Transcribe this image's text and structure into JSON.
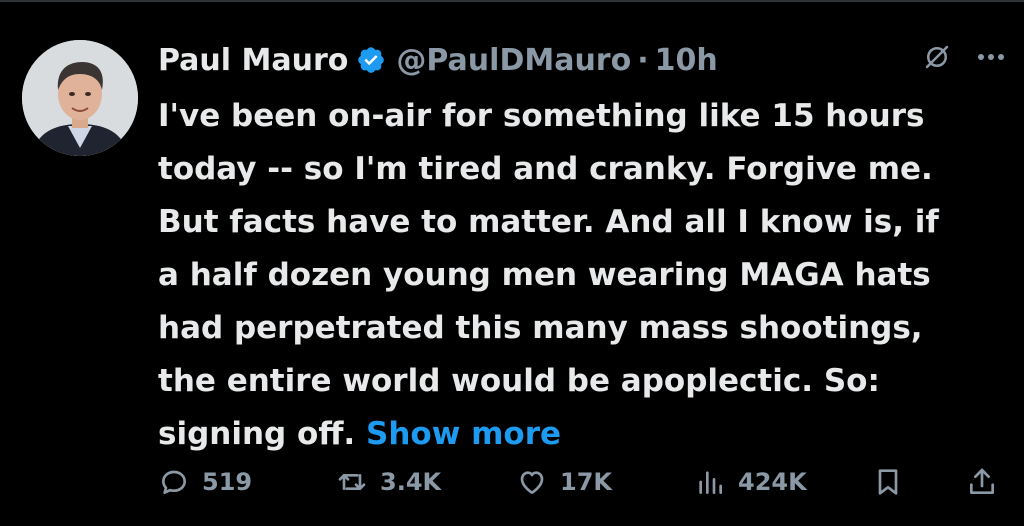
{
  "author": {
    "name": "Paul Mauro",
    "handle": "@PaulDMauro",
    "separator": "·",
    "time": "10h"
  },
  "tweet": {
    "lines": [
      "I've been on-air for something like 15 hours",
      "today -- so I'm tired and cranky.  Forgive me.",
      "But facts have to matter. And all I know is, if",
      "a half dozen young men wearing MAGA hats",
      "had perpetrated this many mass shootings,",
      "the entire world would be apoplectic.  So:",
      "signing off."
    ],
    "show_more": "Show more"
  },
  "actions": {
    "replies": "519",
    "reposts": "3.4K",
    "likes": "17K",
    "views": "424K"
  },
  "colors": {
    "background": "#000000",
    "text": "#e7e9ea",
    "secondary": "#8b98a5",
    "accent": "#1d9bf0"
  },
  "icons": {
    "verified": "verified-badge-icon",
    "grok": "grok-icon",
    "more": "more-icon",
    "reply": "reply-icon",
    "repost": "repost-icon",
    "like": "heart-icon",
    "views": "views-icon",
    "bookmark": "bookmark-icon",
    "share": "share-icon"
  }
}
